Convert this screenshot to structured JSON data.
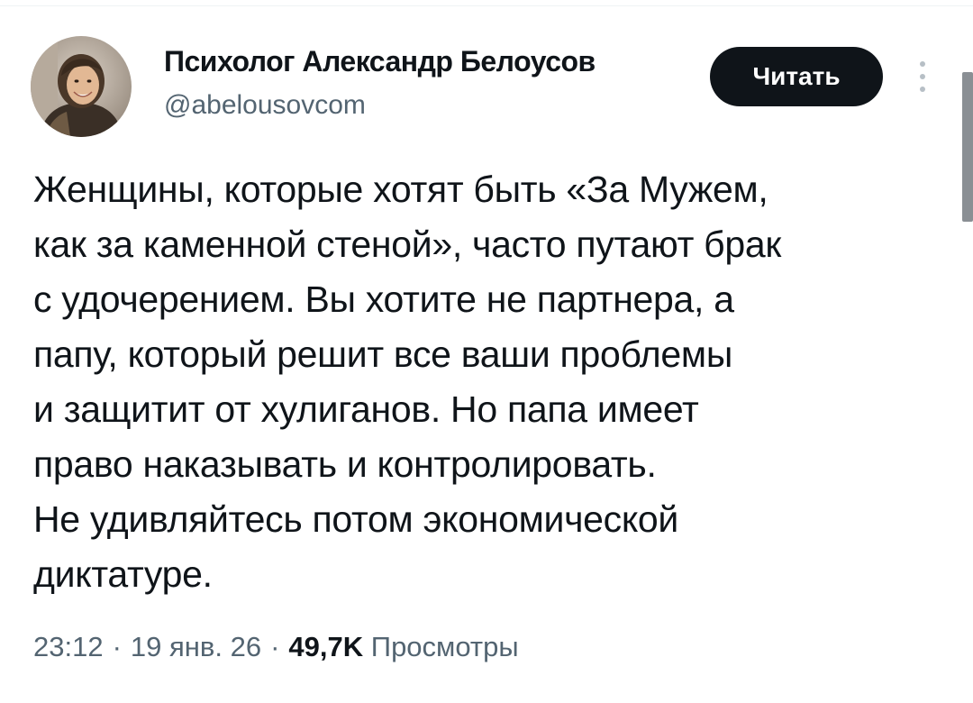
{
  "author": {
    "name": "Психолог Александр Белоусов",
    "handle": "@abelousovcom"
  },
  "follow_button": {
    "label": "Читать"
  },
  "more_icon": "vertical-ellipsis",
  "tweet": {
    "lines": [
      "Женщины, которые хотят быть «За Мужем,",
      "как за каменной стеной», часто путают брак",
      "с удочерением. Вы хотите не партнера, а",
      "папу, который решит все ваши проблемы",
      "и защитит от хулиганов. Но папа имеет",
      "право наказывать и контролировать.",
      "Не удивляйтесь потом экономической",
      "диктатуре."
    ]
  },
  "meta": {
    "time": "23:12",
    "date": "19 янв. 26",
    "separator": "·",
    "views_count": "49,7K",
    "views_label": "Просмотры"
  },
  "colors": {
    "text_primary": "#0f1419",
    "text_secondary": "#536471",
    "button_bg": "#0f1419",
    "button_text": "#ffffff"
  }
}
